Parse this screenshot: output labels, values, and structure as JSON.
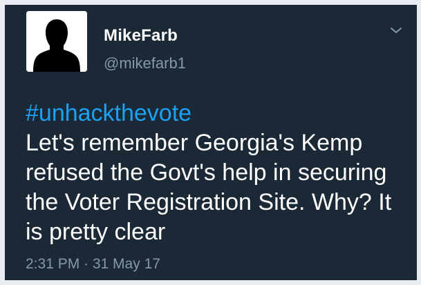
{
  "tweet": {
    "author": {
      "display_name": "MikeFarb",
      "handle": "@mikefarb1",
      "avatar_icon": "default-profile-silhouette-icon"
    },
    "menu_icon": "chevron-down-icon",
    "hashtag": "#unhackthevote",
    "text_lines": [
      "Let's remember Georgia's Kemp",
      "refused the Govt's help in securing",
      "the Voter Registration Site. Why? It",
      "is pretty clear"
    ],
    "timestamp": "2:31 PM · 31 May 17"
  },
  "colors": {
    "background": "#1b2836",
    "frame": "#e9edf1",
    "text": "#ffffff",
    "secondary_text": "#8899a6",
    "link": "#1da1f2"
  }
}
